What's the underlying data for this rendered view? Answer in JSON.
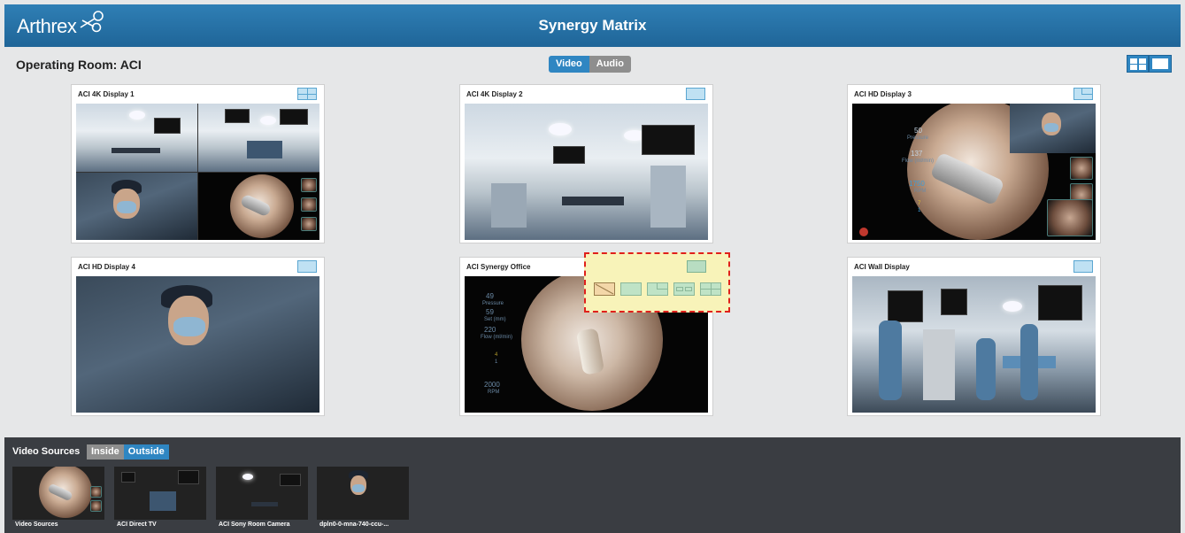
{
  "header": {
    "logo_text": "Arthrex",
    "title": "Synergy Matrix",
    "color": "#1f6598"
  },
  "room": {
    "title": "Operating Room: ACI",
    "mode_tabs": [
      {
        "label": "Video",
        "active": true
      },
      {
        "label": "Audio",
        "active": false
      }
    ],
    "view_toggle": [
      "quad-layout-icon",
      "single-layout-icon"
    ]
  },
  "displays": [
    {
      "title": "ACI 4K Display 1",
      "layout": "quad"
    },
    {
      "title": "ACI 4K Display 2",
      "layout": "single"
    },
    {
      "title": "ACI HD Display 3",
      "layout": "picture-in-picture"
    },
    {
      "title": "ACI HD Display 4",
      "layout": "single"
    },
    {
      "title": "ACI Synergy Office",
      "layout": "single"
    },
    {
      "title": "ACI Wall Display",
      "layout": "single"
    }
  ],
  "scope_overlay": {
    "display3": [
      "50",
      "Pressure",
      "137",
      "Flow (ml/min)",
      "1750",
      "RPM",
      "7",
      "1"
    ],
    "office": [
      "49",
      "Pressure",
      "59",
      "Set (mm)",
      "220",
      "Flow (ml/min)",
      "4",
      "1",
      "2000",
      "RPM"
    ]
  },
  "layout_popup": {
    "options": [
      "no-layout",
      "single",
      "pip",
      "side-by-side",
      "quad"
    ],
    "highlight_color": "#e0201b"
  },
  "video_sources": {
    "label": "Video Sources",
    "tabs": [
      {
        "label": "Inside",
        "active": false
      },
      {
        "label": "Outside",
        "active": true
      }
    ],
    "items": [
      {
        "name": "Video Sources"
      },
      {
        "name": "ACI Direct TV"
      },
      {
        "name": "ACI Sony Room Camera"
      },
      {
        "name": "dpln0-0-mna-740-ccu-..."
      }
    ]
  },
  "accent_color": "#2f86c2"
}
